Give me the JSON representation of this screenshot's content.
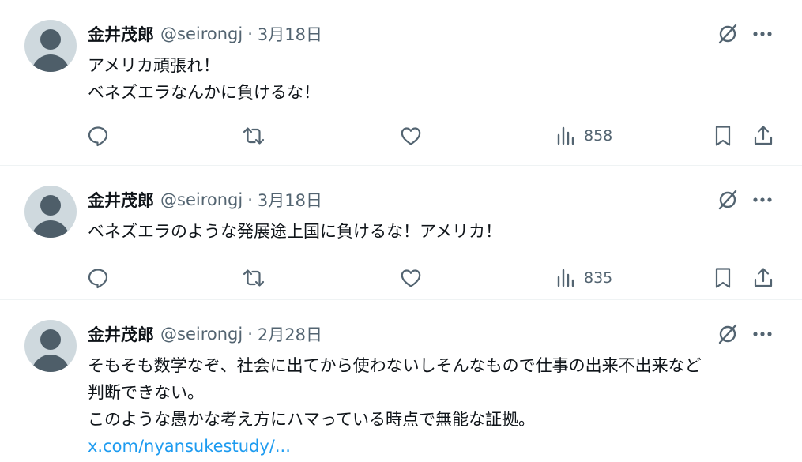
{
  "tweets": [
    {
      "author_name": "金井茂郎",
      "handle": "@seirongj",
      "separator": "·",
      "date": "3月18日",
      "lines": [
        "アメリカ頑張れ！",
        "ベネズエラなんかに負けるな！"
      ],
      "views": "858"
    },
    {
      "author_name": "金井茂郎",
      "handle": "@seirongj",
      "separator": "·",
      "date": "3月18日",
      "lines": [
        "ベネズエラのような発展途上国に負けるな！アメリカ！"
      ],
      "views": "835"
    },
    {
      "author_name": "金井茂郎",
      "handle": "@seirongj",
      "separator": "·",
      "date": "2月28日",
      "lines": [
        "そもそも数学なぞ、社会に出てから使わないしそんなもので仕事の出来不出来など",
        "判断できない。",
        "このような愚かな考え方にハマっている時点で無能な証拠。"
      ],
      "link": "x.com/nyansukestudy/..."
    }
  ],
  "icons": {
    "avatar": "default-avatar-icon",
    "grok": "grok-icon",
    "more": "more-icon",
    "reply": "reply-icon",
    "retweet": "retweet-icon",
    "like": "heart-icon",
    "views": "views-icon",
    "bookmark": "bookmark-icon",
    "share": "share-icon"
  },
  "colors": {
    "text": "#0f1419",
    "secondary": "#536471",
    "link": "#1d9bf0",
    "avatar_bg": "#cfd9de",
    "avatar_fg": "#4e5e69",
    "divider": "#eff3f4"
  }
}
